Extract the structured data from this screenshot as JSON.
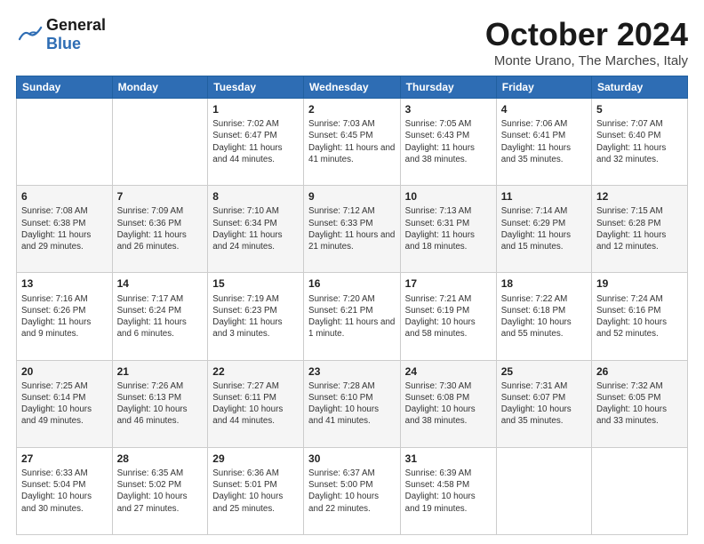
{
  "header": {
    "logo_general": "General",
    "logo_blue": "Blue",
    "title": "October 2024",
    "location": "Monte Urano, The Marches, Italy"
  },
  "weekdays": [
    "Sunday",
    "Monday",
    "Tuesday",
    "Wednesday",
    "Thursday",
    "Friday",
    "Saturday"
  ],
  "weeks": [
    [
      {
        "day": "",
        "info": ""
      },
      {
        "day": "",
        "info": ""
      },
      {
        "day": "1",
        "info": "Sunrise: 7:02 AM\nSunset: 6:47 PM\nDaylight: 11 hours and 44 minutes."
      },
      {
        "day": "2",
        "info": "Sunrise: 7:03 AM\nSunset: 6:45 PM\nDaylight: 11 hours and 41 minutes."
      },
      {
        "day": "3",
        "info": "Sunrise: 7:05 AM\nSunset: 6:43 PM\nDaylight: 11 hours and 38 minutes."
      },
      {
        "day": "4",
        "info": "Sunrise: 7:06 AM\nSunset: 6:41 PM\nDaylight: 11 hours and 35 minutes."
      },
      {
        "day": "5",
        "info": "Sunrise: 7:07 AM\nSunset: 6:40 PM\nDaylight: 11 hours and 32 minutes."
      }
    ],
    [
      {
        "day": "6",
        "info": "Sunrise: 7:08 AM\nSunset: 6:38 PM\nDaylight: 11 hours and 29 minutes."
      },
      {
        "day": "7",
        "info": "Sunrise: 7:09 AM\nSunset: 6:36 PM\nDaylight: 11 hours and 26 minutes."
      },
      {
        "day": "8",
        "info": "Sunrise: 7:10 AM\nSunset: 6:34 PM\nDaylight: 11 hours and 24 minutes."
      },
      {
        "day": "9",
        "info": "Sunrise: 7:12 AM\nSunset: 6:33 PM\nDaylight: 11 hours and 21 minutes."
      },
      {
        "day": "10",
        "info": "Sunrise: 7:13 AM\nSunset: 6:31 PM\nDaylight: 11 hours and 18 minutes."
      },
      {
        "day": "11",
        "info": "Sunrise: 7:14 AM\nSunset: 6:29 PM\nDaylight: 11 hours and 15 minutes."
      },
      {
        "day": "12",
        "info": "Sunrise: 7:15 AM\nSunset: 6:28 PM\nDaylight: 11 hours and 12 minutes."
      }
    ],
    [
      {
        "day": "13",
        "info": "Sunrise: 7:16 AM\nSunset: 6:26 PM\nDaylight: 11 hours and 9 minutes."
      },
      {
        "day": "14",
        "info": "Sunrise: 7:17 AM\nSunset: 6:24 PM\nDaylight: 11 hours and 6 minutes."
      },
      {
        "day": "15",
        "info": "Sunrise: 7:19 AM\nSunset: 6:23 PM\nDaylight: 11 hours and 3 minutes."
      },
      {
        "day": "16",
        "info": "Sunrise: 7:20 AM\nSunset: 6:21 PM\nDaylight: 11 hours and 1 minute."
      },
      {
        "day": "17",
        "info": "Sunrise: 7:21 AM\nSunset: 6:19 PM\nDaylight: 10 hours and 58 minutes."
      },
      {
        "day": "18",
        "info": "Sunrise: 7:22 AM\nSunset: 6:18 PM\nDaylight: 10 hours and 55 minutes."
      },
      {
        "day": "19",
        "info": "Sunrise: 7:24 AM\nSunset: 6:16 PM\nDaylight: 10 hours and 52 minutes."
      }
    ],
    [
      {
        "day": "20",
        "info": "Sunrise: 7:25 AM\nSunset: 6:14 PM\nDaylight: 10 hours and 49 minutes."
      },
      {
        "day": "21",
        "info": "Sunrise: 7:26 AM\nSunset: 6:13 PM\nDaylight: 10 hours and 46 minutes."
      },
      {
        "day": "22",
        "info": "Sunrise: 7:27 AM\nSunset: 6:11 PM\nDaylight: 10 hours and 44 minutes."
      },
      {
        "day": "23",
        "info": "Sunrise: 7:28 AM\nSunset: 6:10 PM\nDaylight: 10 hours and 41 minutes."
      },
      {
        "day": "24",
        "info": "Sunrise: 7:30 AM\nSunset: 6:08 PM\nDaylight: 10 hours and 38 minutes."
      },
      {
        "day": "25",
        "info": "Sunrise: 7:31 AM\nSunset: 6:07 PM\nDaylight: 10 hours and 35 minutes."
      },
      {
        "day": "26",
        "info": "Sunrise: 7:32 AM\nSunset: 6:05 PM\nDaylight: 10 hours and 33 minutes."
      }
    ],
    [
      {
        "day": "27",
        "info": "Sunrise: 6:33 AM\nSunset: 5:04 PM\nDaylight: 10 hours and 30 minutes."
      },
      {
        "day": "28",
        "info": "Sunrise: 6:35 AM\nSunset: 5:02 PM\nDaylight: 10 hours and 27 minutes."
      },
      {
        "day": "29",
        "info": "Sunrise: 6:36 AM\nSunset: 5:01 PM\nDaylight: 10 hours and 25 minutes."
      },
      {
        "day": "30",
        "info": "Sunrise: 6:37 AM\nSunset: 5:00 PM\nDaylight: 10 hours and 22 minutes."
      },
      {
        "day": "31",
        "info": "Sunrise: 6:39 AM\nSunset: 4:58 PM\nDaylight: 10 hours and 19 minutes."
      },
      {
        "day": "",
        "info": ""
      },
      {
        "day": "",
        "info": ""
      }
    ]
  ]
}
